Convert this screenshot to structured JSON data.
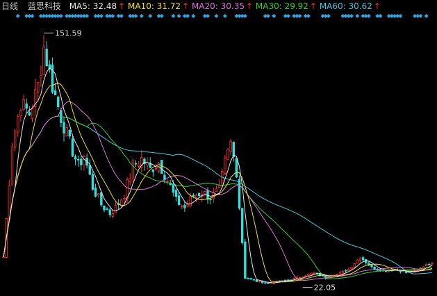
{
  "header": {
    "period": "日线",
    "stock_name": "蓝思科技",
    "indicators": [
      {
        "label": "MA5: 32.48",
        "color": "#e8e8e8"
      },
      {
        "label": "MA10: 31.72",
        "color": "#f0e020"
      },
      {
        "label": "MA20: 30.35",
        "color": "#e070e0"
      },
      {
        "label": "MA30: 29.92",
        "color": "#30d030"
      },
      {
        "label": "MA60: 30.62",
        "color": "#40c8e0"
      }
    ],
    "arrow_glyph": "↑"
  },
  "chart_data": {
    "type": "candlestick",
    "max_label": "151.59",
    "min_label": "22.05",
    "ylim": [
      10,
      165
    ],
    "up_color": "#ff3030",
    "down_color": "#30e0e0",
    "marker_color": "#2aa8e8",
    "ma_colors": {
      "ma5": "#e8e8e8",
      "ma10": "#f0e020",
      "ma20": "#e070e0",
      "ma30": "#30d030",
      "ma60": "#40c8e0"
    },
    "close_anchors": [
      [
        0,
        30
      ],
      [
        3,
        95
      ],
      [
        6,
        118
      ],
      [
        9,
        112
      ],
      [
        12,
        128
      ],
      [
        14,
        150
      ],
      [
        17,
        128
      ],
      [
        20,
        110
      ],
      [
        23,
        95
      ],
      [
        26,
        82
      ],
      [
        28,
        88
      ],
      [
        31,
        70
      ],
      [
        34,
        60
      ],
      [
        37,
        55
      ],
      [
        39,
        58
      ],
      [
        42,
        66
      ],
      [
        45,
        82
      ],
      [
        48,
        86
      ],
      [
        51,
        80
      ],
      [
        54,
        84
      ],
      [
        57,
        74
      ],
      [
        60,
        62
      ],
      [
        63,
        58
      ],
      [
        66,
        65
      ],
      [
        69,
        67
      ],
      [
        72,
        64
      ],
      [
        75,
        68
      ],
      [
        77,
        84
      ],
      [
        79,
        95
      ],
      [
        81,
        79
      ],
      [
        84,
        18
      ],
      [
        88,
        16
      ],
      [
        92,
        15
      ],
      [
        96,
        16
      ],
      [
        100,
        17
      ],
      [
        104,
        19
      ],
      [
        108,
        21
      ],
      [
        112,
        18
      ],
      [
        116,
        20
      ],
      [
        120,
        23
      ],
      [
        124,
        30
      ],
      [
        128,
        24
      ],
      [
        132,
        22
      ],
      [
        136,
        23
      ],
      [
        140,
        21
      ],
      [
        144,
        22
      ],
      [
        147,
        26
      ]
    ]
  }
}
